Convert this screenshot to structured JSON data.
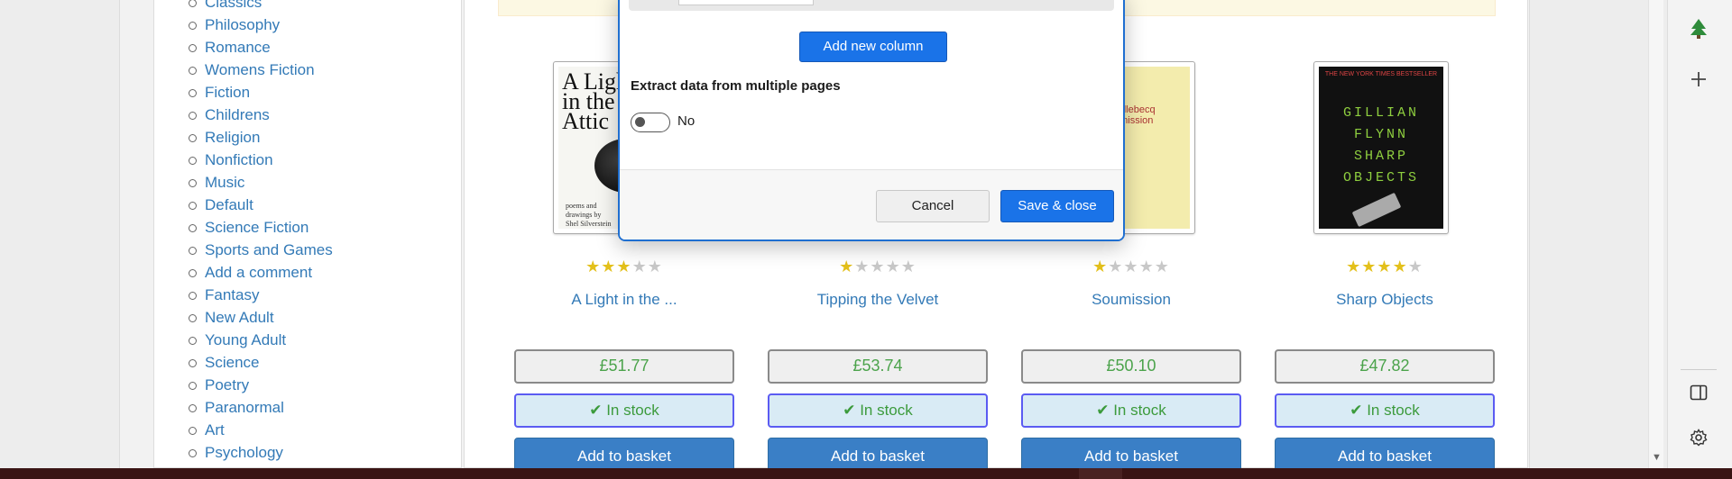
{
  "categories": [
    "Classics",
    "Philosophy",
    "Romance",
    "Womens Fiction",
    "Fiction",
    "Childrens",
    "Religion",
    "Nonfiction",
    "Music",
    "Default",
    "Science Fiction",
    "Sports and Games",
    "Add a comment",
    "Fantasy",
    "New Adult",
    "Young Adult",
    "Science",
    "Poetry",
    "Paranormal",
    "Art",
    "Psychology"
  ],
  "products": [
    {
      "title": "A Light in the ...",
      "price": "£51.77",
      "rating": 3,
      "stock": "In stock",
      "button": "Add to basket",
      "cover": {
        "big": "A Light\nin the\nAttic",
        "small": "poems and\ndrawings by\nShel Silverstein"
      }
    },
    {
      "title": "Tipping the Velvet",
      "price": "£53.74",
      "rating": 1,
      "stock": "In stock",
      "button": "Add to basket"
    },
    {
      "title": "Soumission",
      "price": "£50.10",
      "rating": 1,
      "stock": "In stock",
      "button": "Add to basket",
      "cover": {
        "text": "Houellebecq\nSoumission"
      }
    },
    {
      "title": "Sharp Objects",
      "price": "£47.82",
      "rating": 4,
      "stock": "In stock",
      "button": "Add to basket",
      "cover": {
        "top": "THE NEW YORK TIMES BESTSELLER",
        "name": "GILLIAN\nFLYNN\nSHARP\nOBJECTS"
      }
    }
  ],
  "modal": {
    "add_column_label": "Add new column",
    "extract_label": "Extract data from multiple pages",
    "toggle_value": "No",
    "cancel_label": "Cancel",
    "save_label": "Save & close"
  },
  "side_panel": {
    "icons": [
      "tree-icon",
      "plus-icon",
      "sidebar-toggle-icon",
      "gear-icon"
    ]
  },
  "colors": {
    "accent": "#1a73e8",
    "link": "#337ab7",
    "price": "#4ba34b",
    "star": "#e3c01b"
  }
}
